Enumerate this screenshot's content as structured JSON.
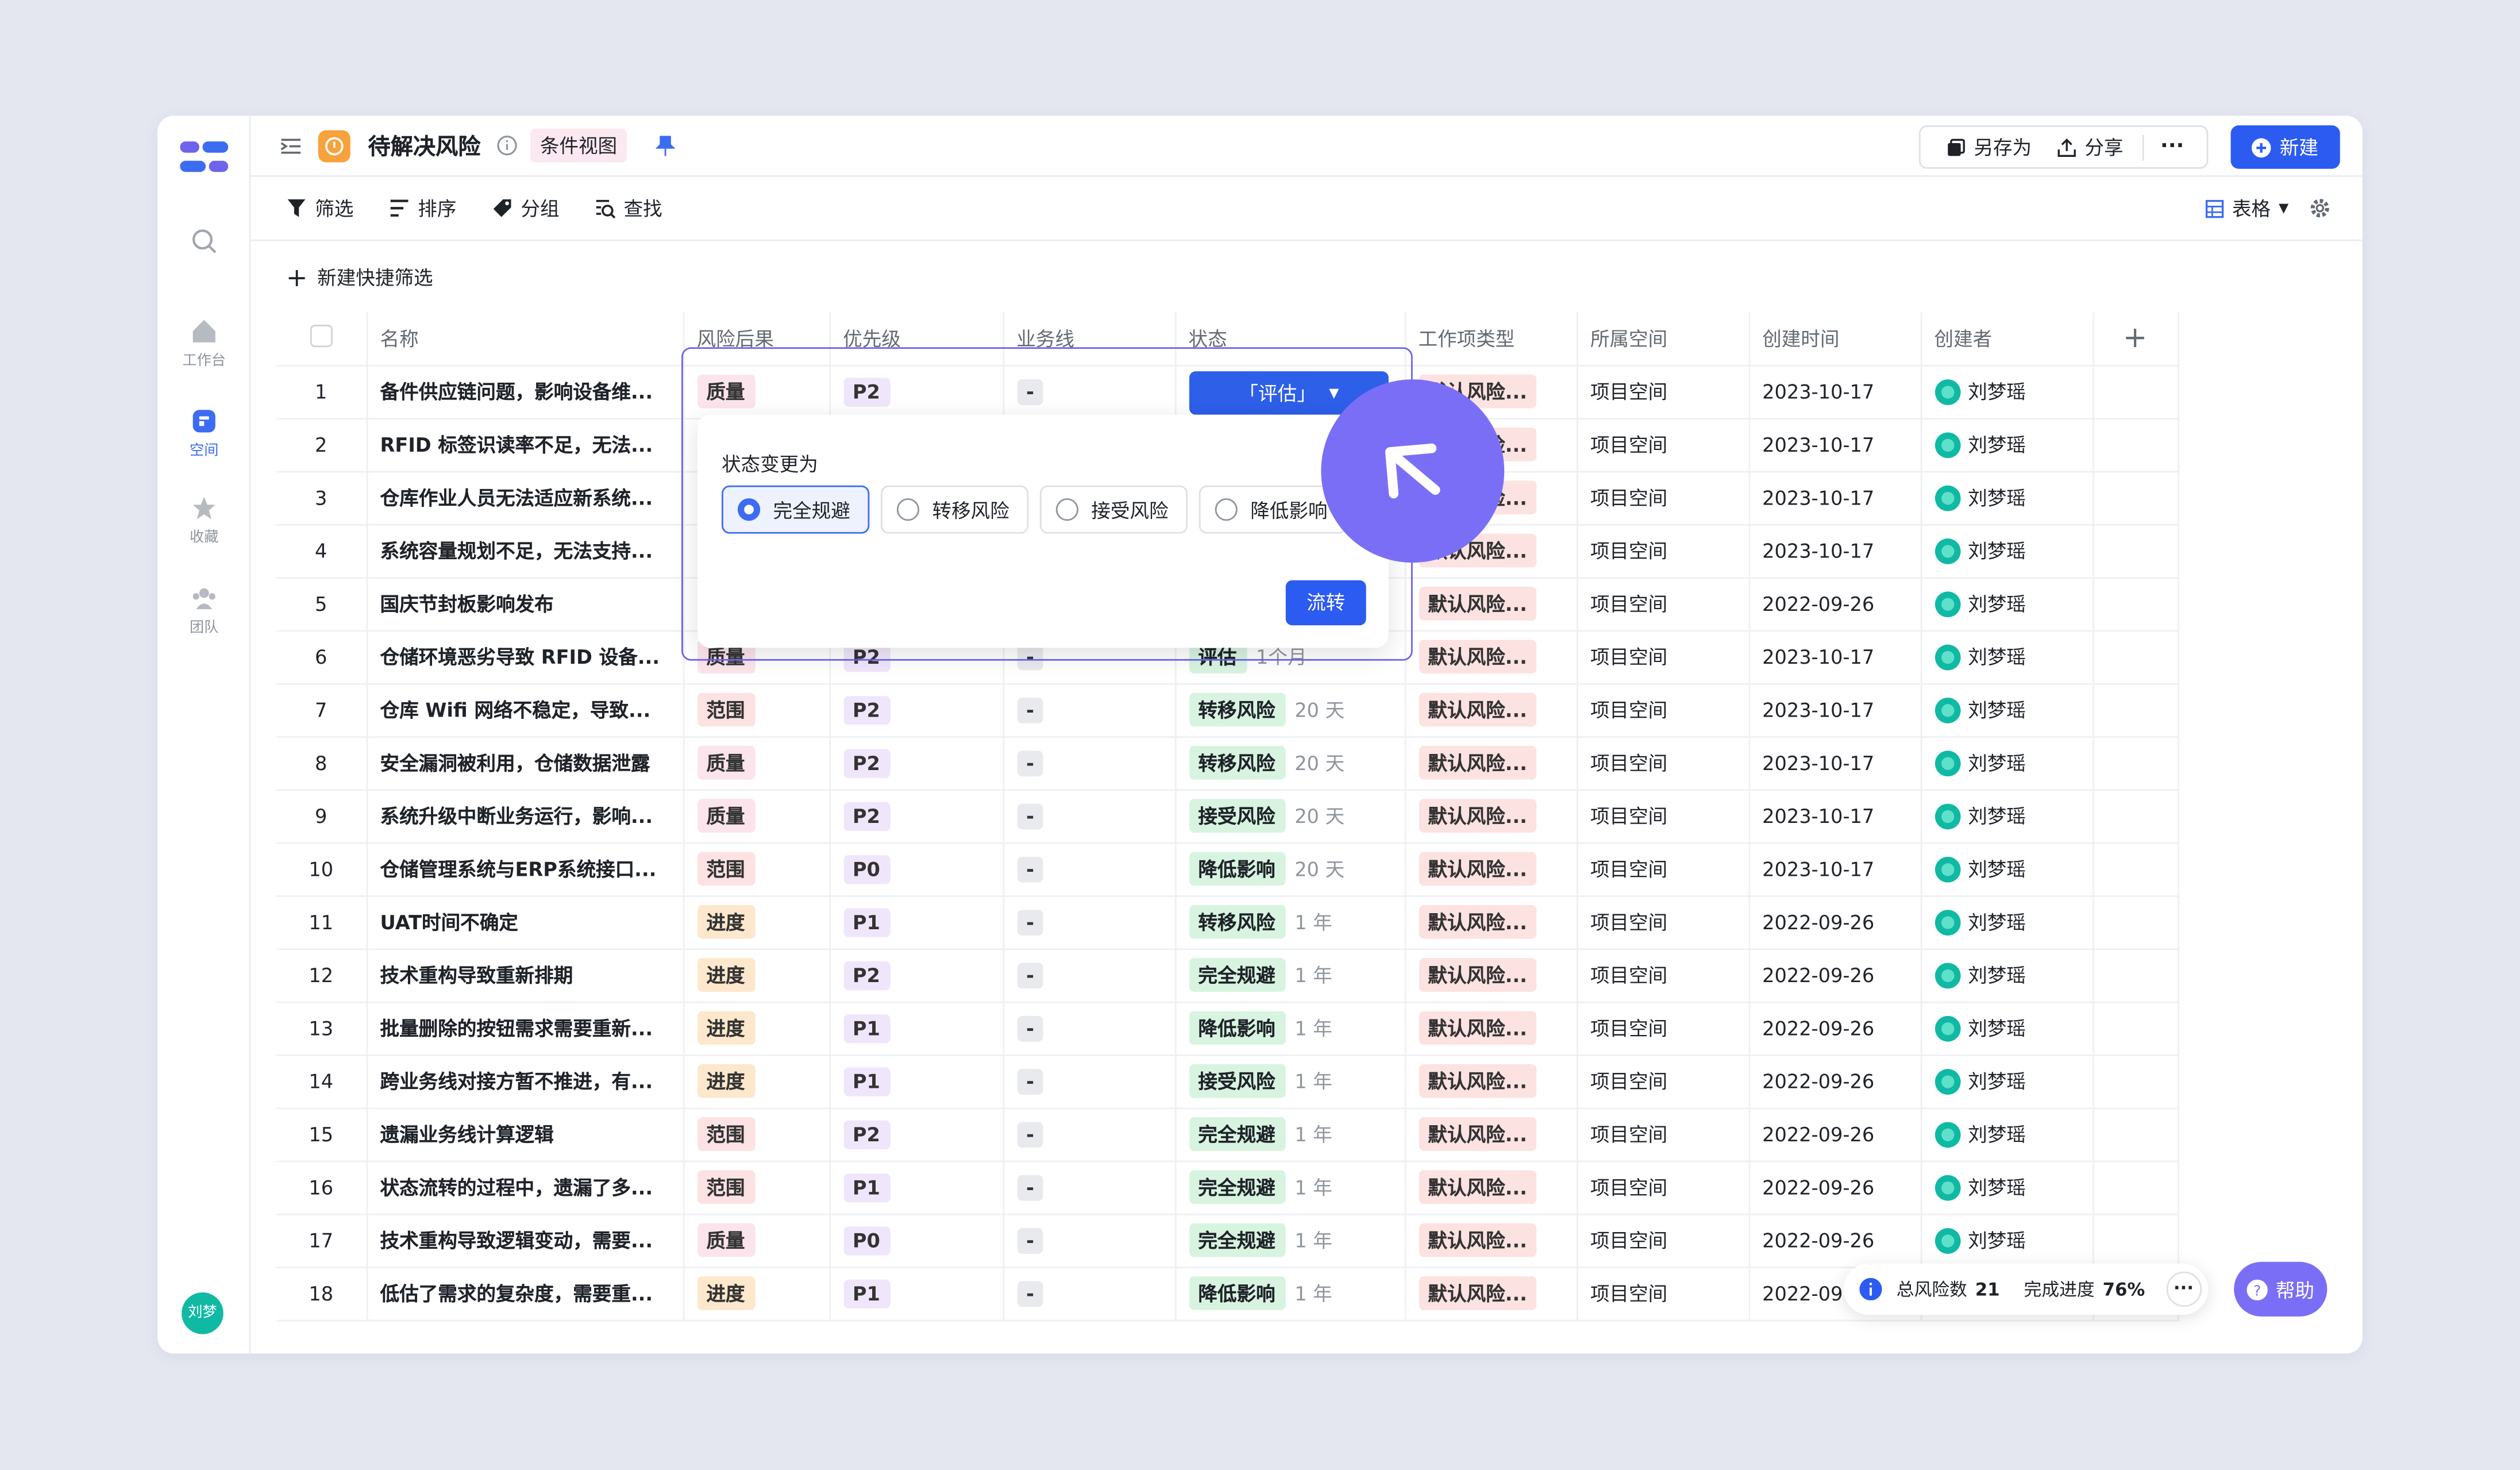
{
  "header": {
    "title": "待解决风险",
    "view_tag": "条件视图",
    "save_as": "另存为",
    "share": "分享",
    "new": "新建"
  },
  "toolbar": {
    "filter": "筛选",
    "sort": "排序",
    "group": "分组",
    "find": "查找",
    "view": "表格"
  },
  "quick_filter": "新建快捷筛选",
  "sidebar": {
    "items": [
      "工作台",
      "空间",
      "收藏",
      "团队"
    ],
    "avatar": "刘梦"
  },
  "columns": [
    "名称",
    "风险后果",
    "优先级",
    "业务线",
    "状态",
    "工作项类型",
    "所属空间",
    "创建时间",
    "创建者"
  ],
  "rows": [
    {
      "n": "1",
      "name": "备件供应链问题，影响设备维...",
      "risk": "质量",
      "pri": "P2",
      "line": "-",
      "status": "「评估」",
      "dur": "",
      "type": "默认风险...",
      "space": "项目空间",
      "date": "2023-10-17",
      "user": "刘梦瑶"
    },
    {
      "n": "2",
      "name": "RFID 标签识读率不足，无法...",
      "risk": "",
      "pri": "",
      "line": "",
      "status": "",
      "dur": "",
      "type": "默认风险...",
      "space": "项目空间",
      "date": "2023-10-17",
      "user": "刘梦瑶"
    },
    {
      "n": "3",
      "name": "仓库作业人员无法适应新系统...",
      "risk": "",
      "pri": "",
      "line": "",
      "status": "",
      "dur": "",
      "type": "默认风险...",
      "space": "项目空间",
      "date": "2023-10-17",
      "user": "刘梦瑶"
    },
    {
      "n": "4",
      "name": "系统容量规划不足，无法支持...",
      "risk": "",
      "pri": "",
      "line": "",
      "status": "",
      "dur": "",
      "type": "默认风险...",
      "space": "项目空间",
      "date": "2023-10-17",
      "user": "刘梦瑶"
    },
    {
      "n": "5",
      "name": "国庆节封板影响发布",
      "risk": "",
      "pri": "",
      "line": "",
      "status": "",
      "dur": "",
      "type": "默认风险...",
      "space": "项目空间",
      "date": "2022-09-26",
      "user": "刘梦瑶"
    },
    {
      "n": "6",
      "name": "仓储环境恶劣导致 RFID 设备...",
      "risk": "质量",
      "pri": "P2",
      "line": "-",
      "status": "评估",
      "dur": "1个月",
      "type": "默认风险...",
      "space": "项目空间",
      "date": "2023-10-17",
      "user": "刘梦瑶"
    },
    {
      "n": "7",
      "name": "仓库 Wifi 网络不稳定，导致...",
      "risk": "范围",
      "pri": "P2",
      "line": "-",
      "status": "转移风险",
      "dur": "20 天",
      "type": "默认风险...",
      "space": "项目空间",
      "date": "2023-10-17",
      "user": "刘梦瑶"
    },
    {
      "n": "8",
      "name": "安全漏洞被利用，仓储数据泄露",
      "risk": "质量",
      "pri": "P2",
      "line": "-",
      "status": "转移风险",
      "dur": "20 天",
      "type": "默认风险...",
      "space": "项目空间",
      "date": "2023-10-17",
      "user": "刘梦瑶"
    },
    {
      "n": "9",
      "name": "系统升级中断业务运行，影响...",
      "risk": "质量",
      "pri": "P2",
      "line": "-",
      "status": "接受风险",
      "dur": "20 天",
      "type": "默认风险...",
      "space": "项目空间",
      "date": "2023-10-17",
      "user": "刘梦瑶"
    },
    {
      "n": "10",
      "name": "仓储管理系统与ERP系统接口...",
      "risk": "范围",
      "pri": "P0",
      "line": "-",
      "status": "降低影响",
      "dur": "20 天",
      "type": "默认风险...",
      "space": "项目空间",
      "date": "2023-10-17",
      "user": "刘梦瑶"
    },
    {
      "n": "11",
      "name": "UAT时间不确定",
      "risk": "进度",
      "pri": "P1",
      "line": "-",
      "status": "转移风险",
      "dur": "1 年",
      "type": "默认风险...",
      "space": "项目空间",
      "date": "2022-09-26",
      "user": "刘梦瑶"
    },
    {
      "n": "12",
      "name": "技术重构导致重新排期",
      "risk": "进度",
      "pri": "P2",
      "line": "-",
      "status": "完全规避",
      "dur": "1 年",
      "type": "默认风险...",
      "space": "项目空间",
      "date": "2022-09-26",
      "user": "刘梦瑶"
    },
    {
      "n": "13",
      "name": "批量删除的按钮需求需要重新...",
      "risk": "进度",
      "pri": "P1",
      "line": "-",
      "status": "降低影响",
      "dur": "1 年",
      "type": "默认风险...",
      "space": "项目空间",
      "date": "2022-09-26",
      "user": "刘梦瑶"
    },
    {
      "n": "14",
      "name": "跨业务线对接方暂不推进，有...",
      "risk": "进度",
      "pri": "P1",
      "line": "-",
      "status": "接受风险",
      "dur": "1 年",
      "type": "默认风险...",
      "space": "项目空间",
      "date": "2022-09-26",
      "user": "刘梦瑶"
    },
    {
      "n": "15",
      "name": "遗漏业务线计算逻辑",
      "risk": "范围",
      "pri": "P2",
      "line": "-",
      "status": "完全规避",
      "dur": "1 年",
      "type": "默认风险...",
      "space": "项目空间",
      "date": "2022-09-26",
      "user": "刘梦瑶"
    },
    {
      "n": "16",
      "name": "状态流转的过程中，遗漏了多...",
      "risk": "范围",
      "pri": "P1",
      "line": "-",
      "status": "完全规避",
      "dur": "1 年",
      "type": "默认风险...",
      "space": "项目空间",
      "date": "2022-09-26",
      "user": "刘梦瑶"
    },
    {
      "n": "17",
      "name": "技术重构导致逻辑变动，需要...",
      "risk": "质量",
      "pri": "P0",
      "line": "-",
      "status": "完全规避",
      "dur": "1 年",
      "type": "默认风险...",
      "space": "项目空间",
      "date": "2022-09-26",
      "user": "刘梦瑶"
    },
    {
      "n": "18",
      "name": "低估了需求的复杂度，需要重...",
      "risk": "进度",
      "pri": "P1",
      "line": "-",
      "status": "降低影响",
      "dur": "1 年",
      "type": "默认风险...",
      "space": "项目空间",
      "date": "2022-09",
      "user": "刘梦瑶"
    }
  ],
  "popup": {
    "title": "状态变更为",
    "options": [
      "完全规避",
      "转移风险",
      "接受风险",
      "降低影响"
    ],
    "selected": "完全规避",
    "submit": "流转"
  },
  "footer": {
    "total_label": "总风险数",
    "total": "21",
    "progress_label": "完成进度",
    "progress": "76%",
    "help": "帮助"
  }
}
